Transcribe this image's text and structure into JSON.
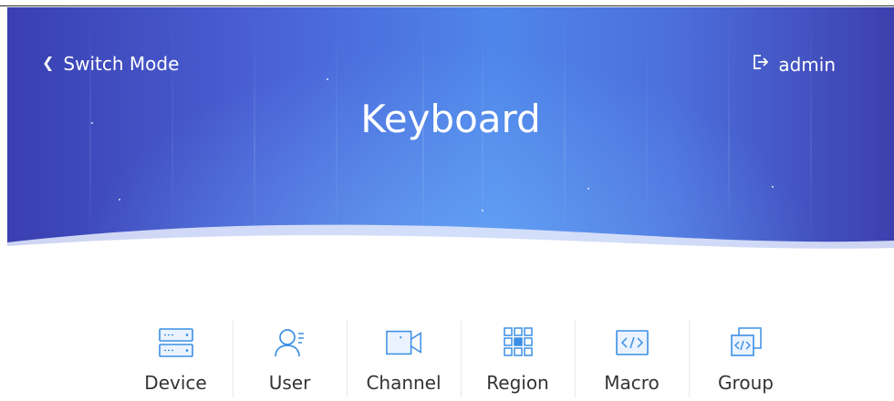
{
  "header": {
    "switch_mode_label": "Switch Mode",
    "title": "Keyboard",
    "user_name": "admin"
  },
  "nav": {
    "items": [
      {
        "label": "Device",
        "icon": "device-icon"
      },
      {
        "label": "User",
        "icon": "user-icon"
      },
      {
        "label": "Channel",
        "icon": "camera-icon"
      },
      {
        "label": "Region",
        "icon": "grid-icon"
      },
      {
        "label": "Macro",
        "icon": "code-icon"
      },
      {
        "label": "Group",
        "icon": "group-code-icon"
      }
    ]
  },
  "colors": {
    "accent": "#3b8fe6",
    "banner_dark": "#3a3fb0",
    "banner_light": "#4f86ea",
    "label_text": "#333333"
  }
}
